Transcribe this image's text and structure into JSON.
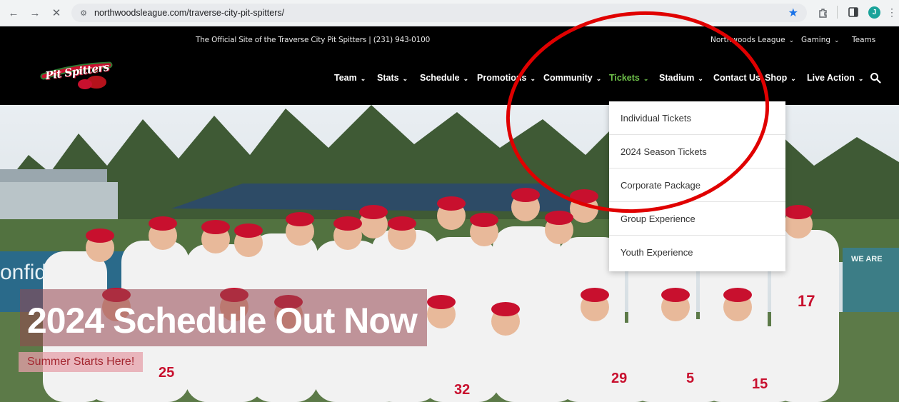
{
  "browser": {
    "url": "northwoodsleague.com/traverse-city-pit-spitters/",
    "profile_initial": "J",
    "nav_icons": [
      "back-arrow-icon",
      "forward-arrow-icon",
      "stop-loading-icon"
    ]
  },
  "topbar": {
    "official_text": "The Official Site of the Traverse City Pit Spitters | (231) 943-0100",
    "links": [
      "Northwoods League",
      "Gaming",
      "Teams"
    ]
  },
  "mainnav": {
    "logo_text": "Pit Spitters",
    "items": [
      "Team",
      "Stats",
      "Schedule",
      "Promotions",
      "Community",
      "Tickets",
      "Stadium",
      "Contact Us",
      "Shop",
      "Live Action"
    ],
    "active": "Tickets",
    "active_color": "#6ec14a"
  },
  "dropdown": {
    "items": [
      "Individual Tickets",
      "2024 Season Tickets",
      "Corporate Package",
      "Group Experience",
      "Youth Experience"
    ]
  },
  "hero": {
    "headline": "2024 Schedule Out Now",
    "cta": "Summer Starts Here!",
    "banner_left": "onfid",
    "banner_right": "WE ARE",
    "jersey_numbers": [
      "25",
      "32",
      "29",
      "17",
      "15",
      "5"
    ]
  },
  "colors": {
    "brand_red": "#c8102e",
    "annotation_red": "#e00000"
  }
}
